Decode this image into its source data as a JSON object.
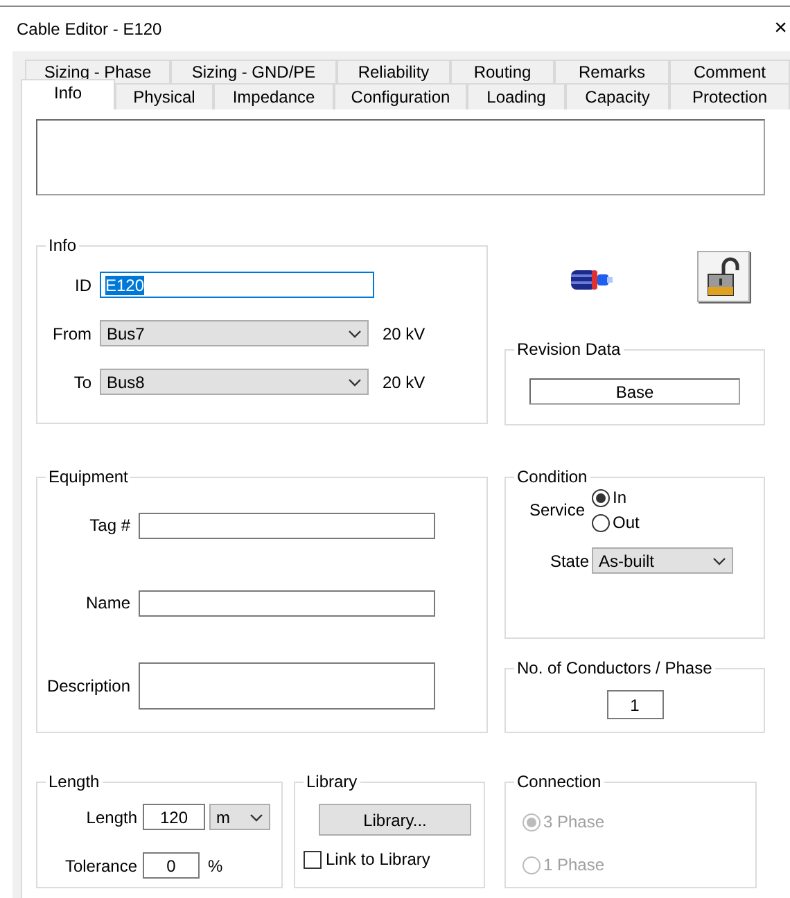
{
  "window": {
    "title": "Cable Editor - E120",
    "close": "×"
  },
  "tabs": [
    [
      {
        "label": "Sizing - Phase",
        "selected": false
      },
      {
        "label": "Sizing - GND/PE",
        "selected": false
      },
      {
        "label": "Reliability",
        "selected": false
      },
      {
        "label": "Routing",
        "selected": false
      },
      {
        "label": "Remarks",
        "selected": false
      },
      {
        "label": "Comment",
        "selected": false
      }
    ],
    [
      {
        "label": "Info",
        "selected": true
      },
      {
        "label": "Physical",
        "selected": false
      },
      {
        "label": "Impedance",
        "selected": false
      },
      {
        "label": "Configuration",
        "selected": false
      },
      {
        "label": "Loading",
        "selected": false
      },
      {
        "label": "Capacity",
        "selected": false
      },
      {
        "label": "Protection",
        "selected": false
      }
    ]
  ],
  "info": {
    "legend": "Info",
    "id": {
      "label": "ID",
      "value": "E120",
      "text_selected": true
    },
    "from": {
      "label": "From",
      "value": "Bus7",
      "unit": "20 kV"
    },
    "to": {
      "label": "To",
      "value": "Bus8",
      "unit": "20 kV"
    }
  },
  "revision": {
    "legend": "Revision Data",
    "value": "Base"
  },
  "equipment": {
    "legend": "Equipment",
    "fields": [
      {
        "label": "Tag #",
        "kind": "line"
      },
      {
        "label": "Name",
        "kind": "line"
      },
      {
        "label": "Description",
        "kind": "multiline"
      }
    ]
  },
  "condition": {
    "legend": "Condition",
    "service": {
      "label": "Service",
      "options": [
        {
          "label": "In",
          "selected": true
        },
        {
          "label": "Out",
          "selected": false
        }
      ]
    },
    "state": {
      "label": "State",
      "value": "As-built"
    }
  },
  "conductors": {
    "legend": "No. of Conductors / Phase",
    "value": "1"
  },
  "length": {
    "legend": "Length",
    "length": {
      "label": "Length",
      "value": "120",
      "unit": "m"
    },
    "tolerance": {
      "label": "Tolerance",
      "value": "0",
      "unit": "%"
    }
  },
  "library": {
    "legend": "Library",
    "button": "Library...",
    "link": {
      "label": "Link to Library",
      "checked": false
    }
  },
  "connection": {
    "legend": "Connection",
    "disabled": true,
    "options": [
      {
        "label": "3 Phase",
        "selected": true
      },
      {
        "label": "1 Phase",
        "selected": false
      }
    ]
  }
}
